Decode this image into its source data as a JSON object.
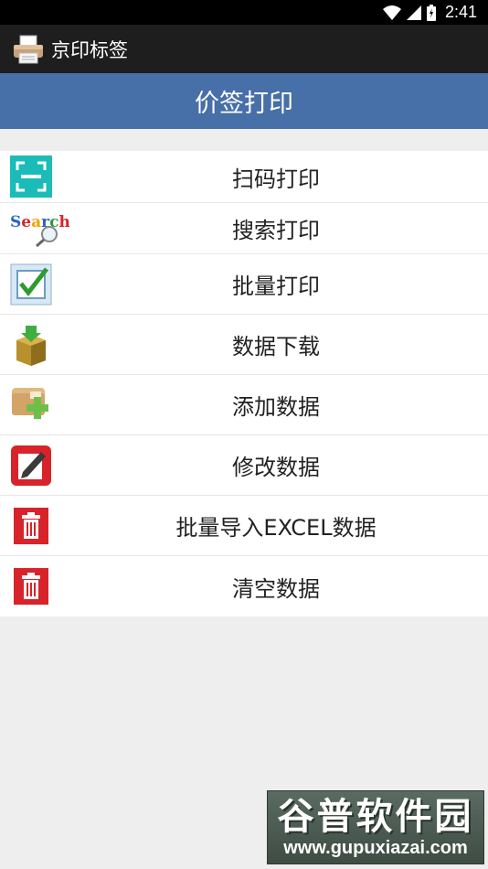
{
  "status_bar": {
    "time": "2:41"
  },
  "app_bar": {
    "title": "京印标签",
    "icon": "printer-icon"
  },
  "banner": {
    "title": "价签打印"
  },
  "menu": {
    "items": [
      {
        "label": "扫码打印",
        "icon": "scan-icon"
      },
      {
        "label": "搜索打印",
        "icon": "search-icon"
      },
      {
        "label": "批量打印",
        "icon": "checkbox-icon"
      },
      {
        "label": "数据下载",
        "icon": "download-box-icon"
      },
      {
        "label": "添加数据",
        "icon": "add-folder-icon"
      },
      {
        "label": "修改数据",
        "icon": "edit-icon"
      },
      {
        "label": "批量导入EXCEL数据",
        "icon": "trash-icon"
      },
      {
        "label": "清空数据",
        "icon": "trash-icon"
      }
    ]
  },
  "watermark": {
    "title": "谷普软件园",
    "url": "www.gupuxiazai.com",
    "search_icon_text": "Search"
  },
  "colors": {
    "banner": "#476fa8",
    "app_bar": "#1e1e1e",
    "status_bar": "#000000",
    "background": "#eeeeee"
  }
}
